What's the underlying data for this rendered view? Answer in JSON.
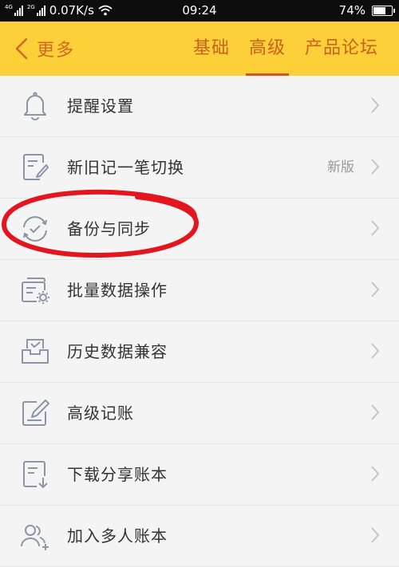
{
  "status_bar": {
    "network_1": "4G",
    "network_2": "2G",
    "speed": "0.07K/s",
    "time": "09:24",
    "battery": "74%",
    "battery_level": 0.74
  },
  "header": {
    "back_label": "更多",
    "tabs": [
      {
        "label": "基础",
        "active": false
      },
      {
        "label": "高级",
        "active": true
      },
      {
        "label": "产品论坛",
        "active": false
      }
    ]
  },
  "menu": {
    "items": [
      {
        "label": "提醒设置",
        "icon": "bell-icon",
        "badge": ""
      },
      {
        "label": "新旧记一笔切换",
        "icon": "edit-note-icon",
        "badge": "新版"
      },
      {
        "label": "备份与同步",
        "icon": "sync-check-icon",
        "badge": ""
      },
      {
        "label": "批量数据操作",
        "icon": "batch-settings-icon",
        "badge": ""
      },
      {
        "label": "历史数据兼容",
        "icon": "inbox-icon",
        "badge": ""
      },
      {
        "label": "高级记账",
        "icon": "pencil-box-icon",
        "badge": ""
      },
      {
        "label": "下载分享账本",
        "icon": "book-download-icon",
        "badge": ""
      },
      {
        "label": "加入多人账本",
        "icon": "add-users-icon",
        "badge": ""
      }
    ]
  },
  "colors": {
    "header_bg": "#fdd03a",
    "accent": "#c9621c",
    "annotation": "#e3161f"
  }
}
